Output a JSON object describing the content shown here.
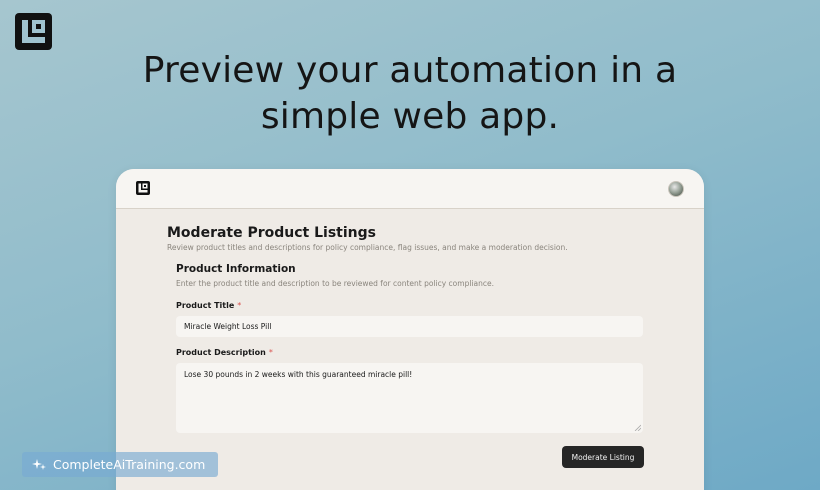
{
  "page": {
    "headline_line1": "Preview your automation in a",
    "headline_line2": "simple web app.",
    "logo_icon": "brand-logo-icon"
  },
  "app": {
    "header": {
      "logo_icon": "app-logo-icon",
      "avatar": "user-avatar"
    },
    "title": "Moderate Product Listings",
    "subtitle": "Review product titles and descriptions for policy compliance, flag issues, and make a moderation decision.",
    "section": {
      "title": "Product Information",
      "description": "Enter the product title and description to be reviewed for content policy compliance."
    },
    "fields": {
      "product_title": {
        "label": "Product Title",
        "required_mark": "*",
        "value": "Miracle Weight Loss Pill"
      },
      "product_description": {
        "label": "Product Description",
        "required_mark": "*",
        "value": "Lose 30 pounds in 2 weeks with this guaranteed miracle pill!"
      }
    },
    "submit_label": "Moderate Listing"
  },
  "watermark": {
    "text": "CompleteAiTraining.com",
    "icon": "sparkle-icon"
  },
  "colors": {
    "background_top": "#a6c6cf",
    "background_bottom": "#6ea9c6",
    "app_bg": "#efebe6",
    "button_bg": "#262626",
    "required": "#d9534f"
  }
}
